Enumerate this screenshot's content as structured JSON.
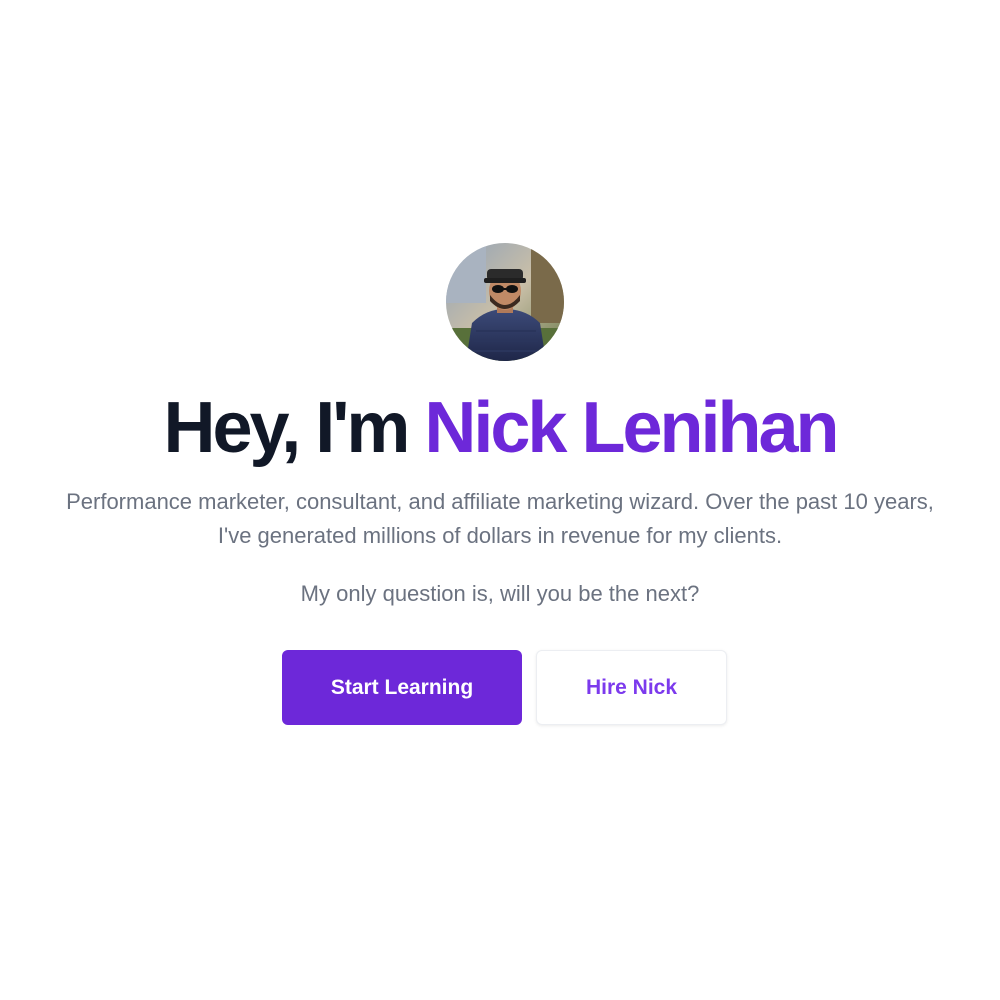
{
  "hero": {
    "avatar_alt": "Nick Lenihan",
    "headline_prefix": "Hey, I'm",
    "headline_name": "Nick Lenihan",
    "lead": "Performance marketer, consultant, and affiliate marketing wizard. Over the past 10 years, I've generated millions of dollars in revenue for my clients.",
    "question": "My only question is, will you be the next?"
  },
  "actions": {
    "primary_label": "Start Learning",
    "secondary_label": "Hire Nick"
  },
  "colors": {
    "accent": "#6d28d9",
    "heading": "#111827",
    "body_text": "#6b7280",
    "secondary_button_text": "#7c3aed"
  }
}
